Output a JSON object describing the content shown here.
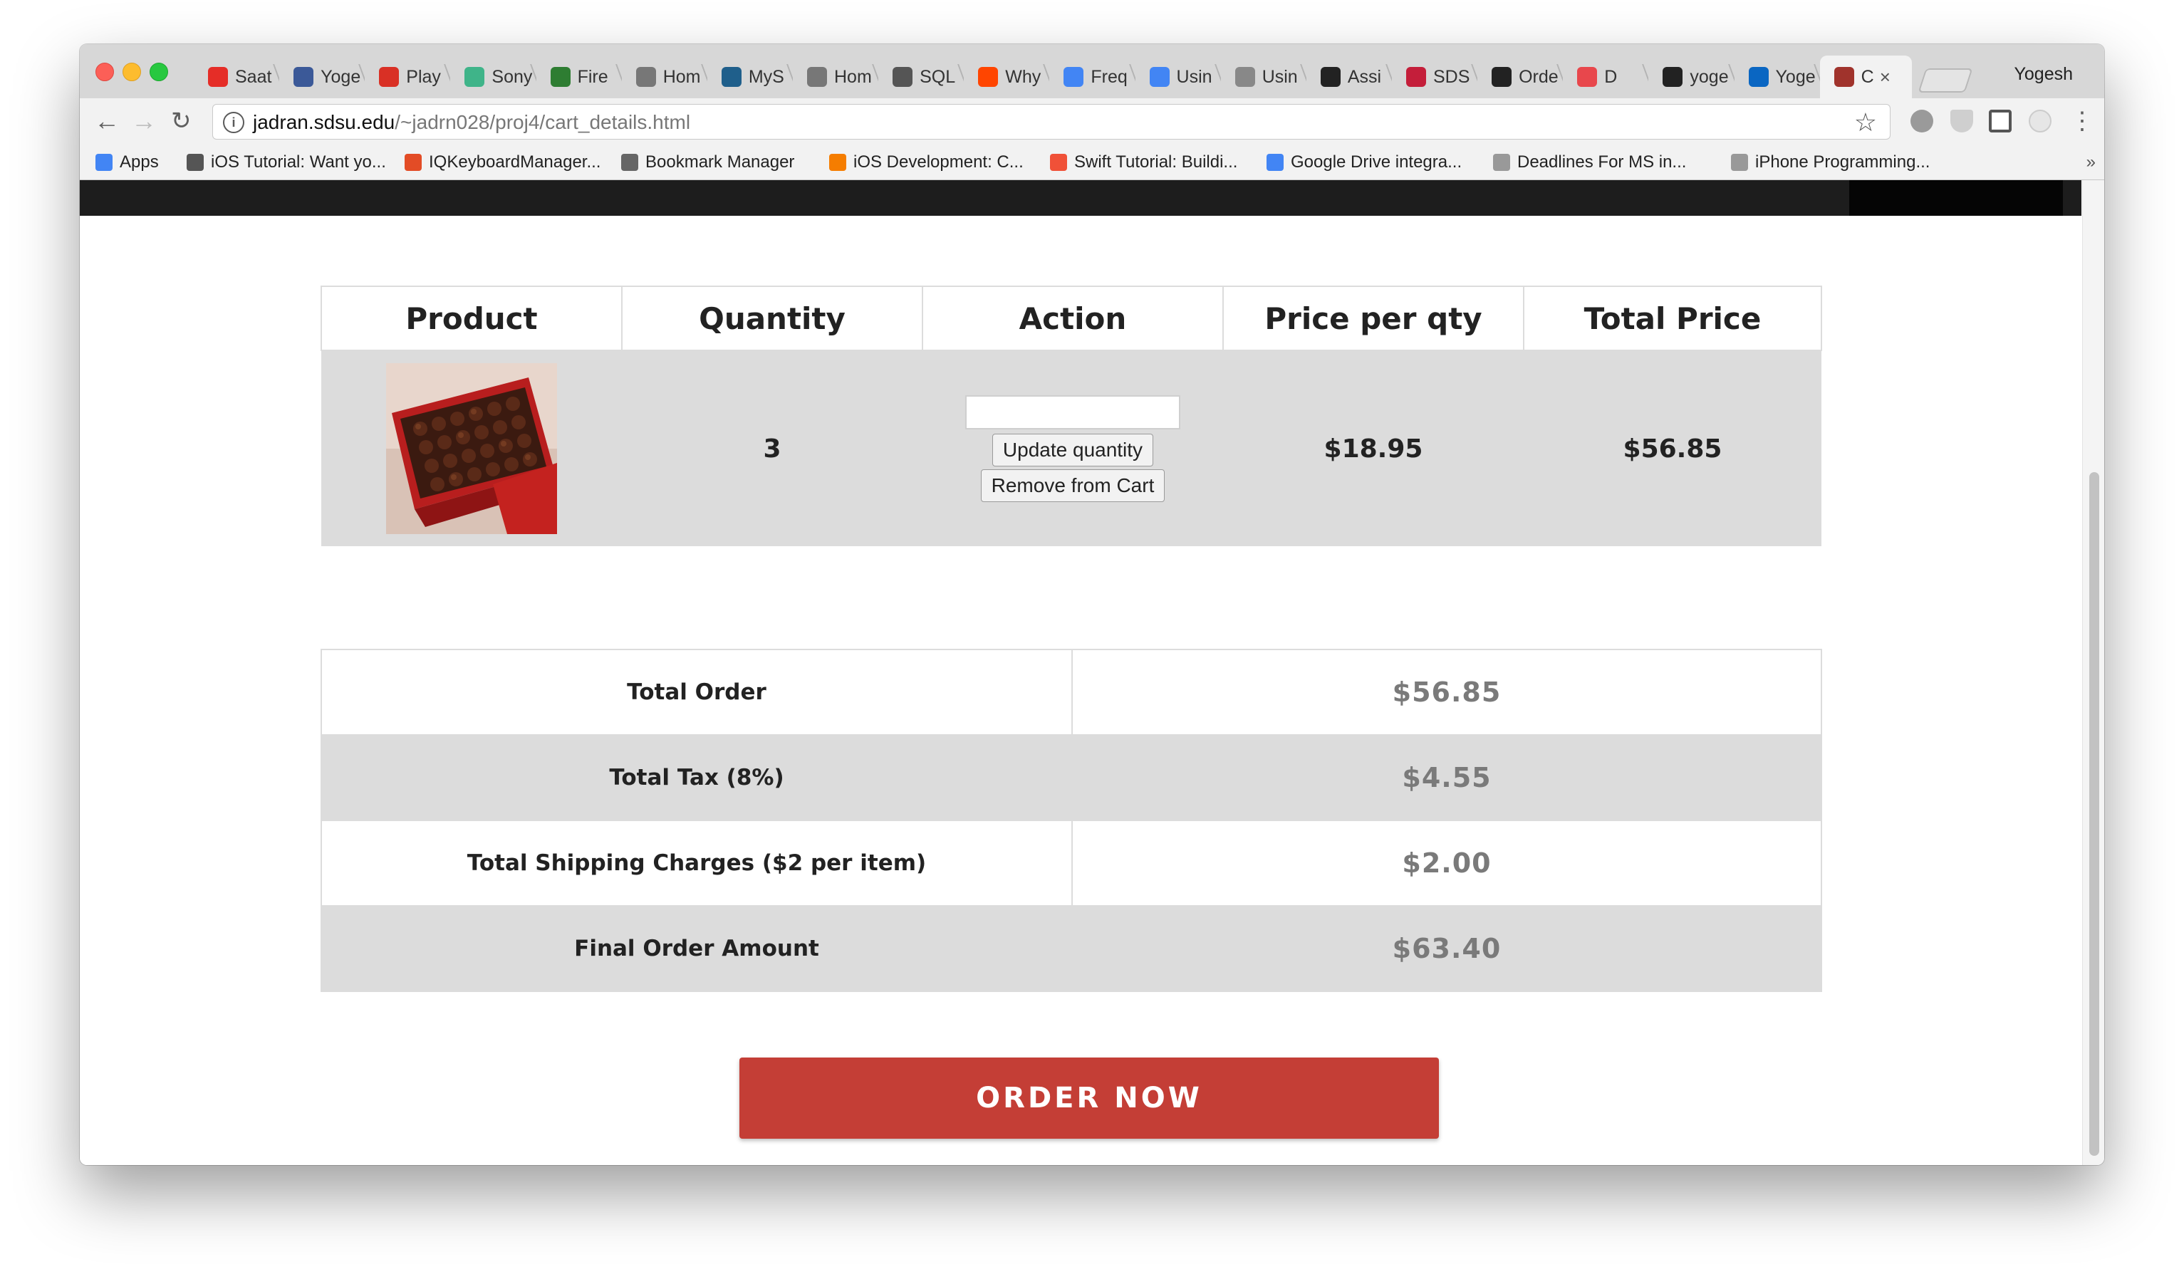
{
  "browser": {
    "profile_name": "Yogesh",
    "tabs": [
      {
        "label": "Saat",
        "icon": "youtube-icon",
        "color": "#e52d27"
      },
      {
        "label": "Yoge",
        "icon": "facebook-icon",
        "color": "#3b5998"
      },
      {
        "label": "Play",
        "icon": "gmail-icon",
        "color": "#d93025"
      },
      {
        "label": "Sony",
        "icon": "sony-app-icon",
        "color": "#3fb489"
      },
      {
        "label": "Fire",
        "icon": "firebase-icon",
        "color": "#2e7d32"
      },
      {
        "label": "Hom",
        "icon": "settings-icon",
        "color": "#777777"
      },
      {
        "label": "MyS",
        "icon": "mysql-icon",
        "color": "#1f5f8b"
      },
      {
        "label": "Hom",
        "icon": "settings-icon",
        "color": "#777777"
      },
      {
        "label": "SQL",
        "icon": "stack-icon",
        "color": "#555555"
      },
      {
        "label": "Why",
        "icon": "reddit-icon",
        "color": "#ff4500"
      },
      {
        "label": "Freq",
        "icon": "google-icon",
        "color": "#4285f4"
      },
      {
        "label": "Usin",
        "icon": "google-icon",
        "color": "#4285f4"
      },
      {
        "label": "Usin",
        "icon": "document-icon",
        "color": "#888888"
      },
      {
        "label": "Assi",
        "icon": "blackboard-icon",
        "color": "#222222"
      },
      {
        "label": "SDS",
        "icon": "sdsu-icon",
        "color": "#c41e3a"
      },
      {
        "label": "Orde",
        "icon": "github-icon",
        "color": "#222222"
      },
      {
        "label": "D",
        "icon": "grammarly-icon",
        "color": "#e8474c"
      },
      {
        "label": "yoge",
        "icon": "github-icon",
        "color": "#222222"
      },
      {
        "label": "Yoge",
        "icon": "linkedin-icon",
        "color": "#0a66c2"
      },
      {
        "label": "C",
        "icon": "site-icon",
        "color": "#a0332c",
        "active": true
      }
    ],
    "url_host": "jadran.sdsu.edu",
    "url_path": "/~jadrn028/proj4/cart_details.html",
    "bookmarks": [
      {
        "label": "Apps",
        "icon": "apps-grid-icon"
      },
      {
        "label": "iOS Tutorial: Want yo...",
        "icon": "ios-tutorial-icon"
      },
      {
        "label": "IQKeyboardManager...",
        "icon": "iqkeyboard-icon"
      },
      {
        "label": "Bookmark Manager",
        "icon": "star-icon"
      },
      {
        "label": "iOS Development: C...",
        "icon": "blogger-icon"
      },
      {
        "label": "Swift Tutorial: Buildi...",
        "icon": "swift-icon"
      },
      {
        "label": "Google Drive integra...",
        "icon": "google-drive-icon"
      },
      {
        "label": "Deadlines For MS in...",
        "icon": "document-icon"
      },
      {
        "label": "iPhone Programming...",
        "icon": "document-icon"
      }
    ]
  },
  "cart": {
    "headers": [
      "Product",
      "Quantity",
      "Action",
      "Price per qty",
      "Total Price"
    ],
    "item": {
      "product_image": "chocolate-box-image",
      "quantity": "3",
      "qty_input_value": "",
      "update_label": "Update quantity",
      "remove_label": "Remove from Cart",
      "price_per_qty": "$18.95",
      "total_price": "$56.85"
    }
  },
  "summary": [
    {
      "label": "Total Order",
      "value": "$56.85"
    },
    {
      "label": "Total Tax (8%)",
      "value": "$4.55"
    },
    {
      "label": "Total Shipping Charges ($2 per item)",
      "value": "$2.00"
    },
    {
      "label": "Final Order Amount",
      "value": "$63.40"
    }
  ],
  "order_button": "ORDER NOW",
  "colors": {
    "accent": "#c43e36",
    "nav_bg": "#1d1d1d",
    "row_shade": "#dcdcdc"
  }
}
